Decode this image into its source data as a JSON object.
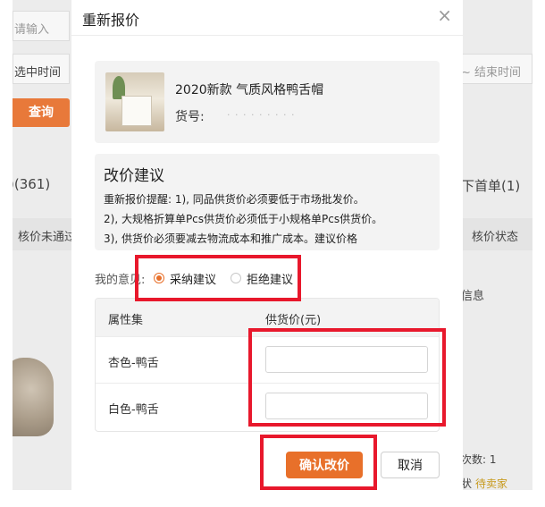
{
  "background": {
    "left": {
      "search_placeholder": "请输入",
      "select_time": "选中时间",
      "query_button": "查询",
      "tab_count": ")(361)",
      "tab_unapproved": "核价未通过"
    },
    "right": {
      "end_time": "~ 结束时间",
      "tab_first_order": "下首单(1)",
      "col_price_status": "核价状态",
      "col_info": "信息",
      "times": "次数: 1",
      "status_label": "状",
      "status_value": "待卖家"
    }
  },
  "dialog": {
    "title": "重新报价",
    "close_icon": "×",
    "product": {
      "name": "2020新款 气质风格鸭舌帽",
      "sku_label": "货号:",
      "sku_value": "·  · · ·  · · · · ·",
      "thumbnail_icon": "product-thumbnail"
    },
    "suggestion": {
      "title": "改价建议",
      "lines": [
        "重新报价提醒: 1), 同品供货价必须要低于市场批发价。",
        "2), 大规格折算单Pcs供货价必须低于小规格单Pcs供货价。",
        "3), 供货价必须要减去物流成本和推广成本。建议价格"
      ]
    },
    "opinion": {
      "label": "我的意见:",
      "options": [
        {
          "label": "采纳建议",
          "selected": true
        },
        {
          "label": "拒绝建议",
          "selected": false
        }
      ]
    },
    "table": {
      "headers": [
        "属性集",
        "供货价(元)"
      ],
      "rows": [
        {
          "attribute": "杏色-鸭舌",
          "price": ""
        },
        {
          "attribute": "白色-鸭舌",
          "price": ""
        }
      ]
    },
    "buttons": {
      "confirm": "确认改价",
      "cancel": "取消"
    }
  },
  "colors": {
    "accent": "#e8702a",
    "highlight": "#e8182c",
    "status_gold": "#c79a1e"
  }
}
